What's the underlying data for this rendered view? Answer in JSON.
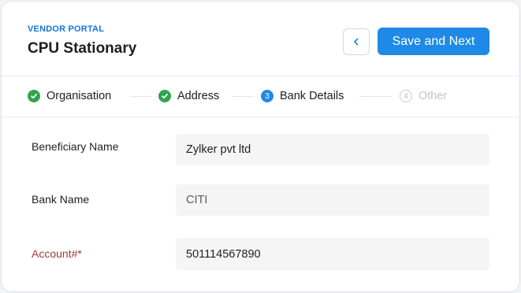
{
  "header": {
    "portal_label": "VENDOR PORTAL",
    "title": "CPU Stationary",
    "save_label": "Save and Next"
  },
  "steps": [
    {
      "label": "Organisation",
      "state": "done"
    },
    {
      "label": "Address",
      "state": "done"
    },
    {
      "label": "Bank Details",
      "state": "active",
      "number": "3"
    },
    {
      "label": "Other",
      "state": "pending",
      "number": "4"
    }
  ],
  "form": {
    "beneficiary_label": "Beneficiary Name",
    "beneficiary_value": "Zylker pvt ltd",
    "bank_label": "Bank Name",
    "bank_value": "CITI",
    "account_label": "Account#*",
    "account_value": "501114567890"
  },
  "colors": {
    "accent": "#1f8ae6",
    "brand_label": "#1a73d9",
    "success": "#2ea44f",
    "required": "#a13a3a"
  }
}
